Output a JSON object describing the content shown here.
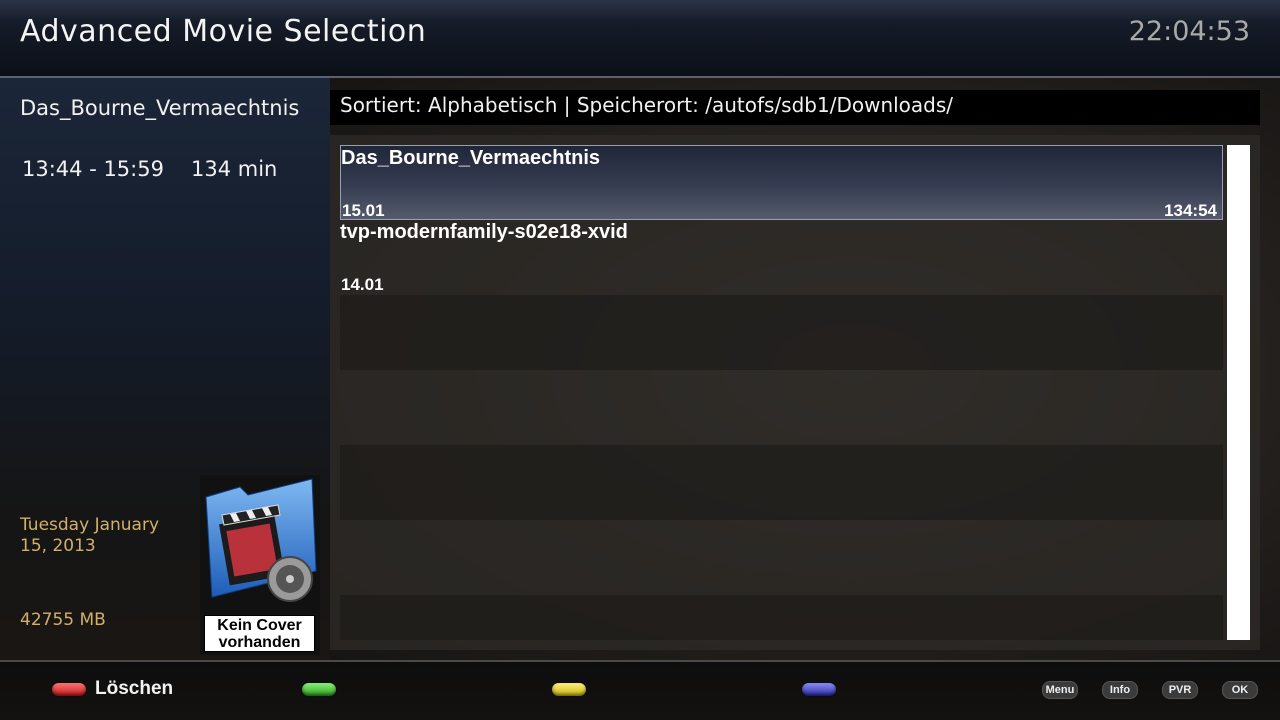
{
  "header": {
    "title": "Advanced Movie Selection",
    "clock": "22:04:53"
  },
  "details": {
    "title": "Das_Bourne_Vermaechtnis",
    "time_range": "13:44 - 15:59",
    "duration": "134 min",
    "date": "Tuesday January 15, 2013",
    "free_space": "42755 MB",
    "cover_text_line1": "Kein Cover",
    "cover_text_line2": "vorhanden"
  },
  "sort_bar": {
    "text": "Sortiert: Alphabetisch | Speicherort: /autofs/sdb1/Downloads/"
  },
  "movies": [
    {
      "title": "Das_Bourne_Vermaechtnis",
      "date": "15.01",
      "length": "134:54",
      "selected": true
    },
    {
      "title": "tvp-modernfamily-s02e18-xvid",
      "date": "14.01",
      "length": "",
      "selected": false
    }
  ],
  "footer": {
    "red_label": "Löschen",
    "green_label": "",
    "yellow_label": "",
    "blue_label": "",
    "keys": [
      "Menu",
      "Info",
      "PVR",
      "OK"
    ]
  },
  "colors": {
    "accent_date": "#d1b06a",
    "red": "#d83030",
    "green": "#3cb62c",
    "yellow": "#d8c81e",
    "blue": "#3a3db5"
  }
}
